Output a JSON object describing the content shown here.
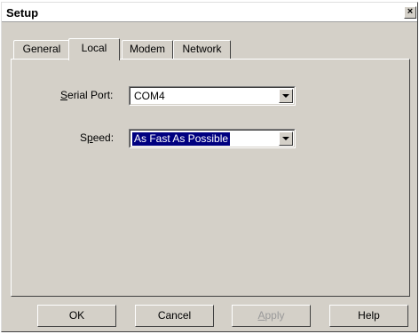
{
  "window": {
    "title": "Setup",
    "close_glyph": "×"
  },
  "tabs": [
    {
      "label": "General",
      "active": false
    },
    {
      "label": "Local",
      "active": true
    },
    {
      "label": "Modem",
      "active": false
    },
    {
      "label": "Network",
      "active": false
    }
  ],
  "local": {
    "serial_port": {
      "label_mnemonic": "S",
      "label_rest": "erial Port:",
      "value": "COM4"
    },
    "speed": {
      "label_pre": "S",
      "label_mnemonic": "p",
      "label_rest": "eed:",
      "value": "As Fast As Possible"
    }
  },
  "buttons": {
    "ok": "OK",
    "cancel": "Cancel",
    "apply_mnemonic": "A",
    "apply_rest": "pply",
    "help": "Help"
  },
  "colors": {
    "face": "#d4d0c8",
    "selection": "#000080"
  },
  "icons": {
    "close": "close-icon",
    "dropdown": "chevron-down-icon"
  }
}
